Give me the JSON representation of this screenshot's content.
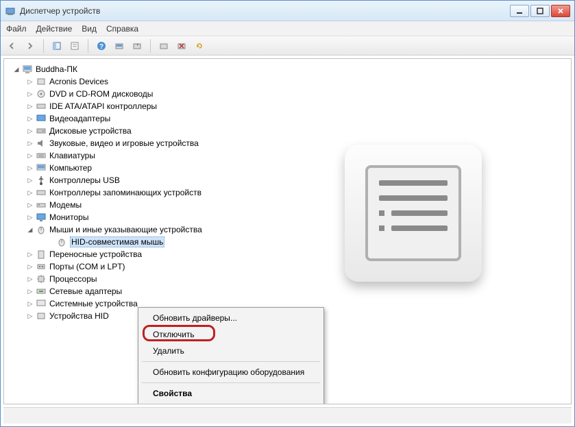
{
  "window": {
    "title": "Диспетчер устройств"
  },
  "menu": {
    "file": "Файл",
    "action": "Действие",
    "view": "Вид",
    "help": "Справка"
  },
  "tree": {
    "root": "Buddha-ПК",
    "items": [
      "Acronis Devices",
      "DVD и CD-ROM дисководы",
      "IDE ATA/ATAPI контроллеры",
      "Видеоадаптеры",
      "Дисковые устройства",
      "Звуковые, видео и игровые устройства",
      "Клавиатуры",
      "Компьютер",
      "Контроллеры USB",
      "Контроллеры запоминающих устройств",
      "Модемы",
      "Мониторы",
      "Мыши и иные указывающие устройства",
      "Переносные устройства",
      "Порты (COM и LPT)",
      "Процессоры",
      "Сетевые адаптеры",
      "Системные устройства",
      "Устройства HID"
    ],
    "selected_child": "HID-совместимая мышь"
  },
  "context_menu": {
    "update_drivers": "Обновить драйверы...",
    "disable": "Отключить",
    "delete": "Удалить",
    "scan": "Обновить конфигурацию оборудования",
    "properties": "Свойства"
  }
}
